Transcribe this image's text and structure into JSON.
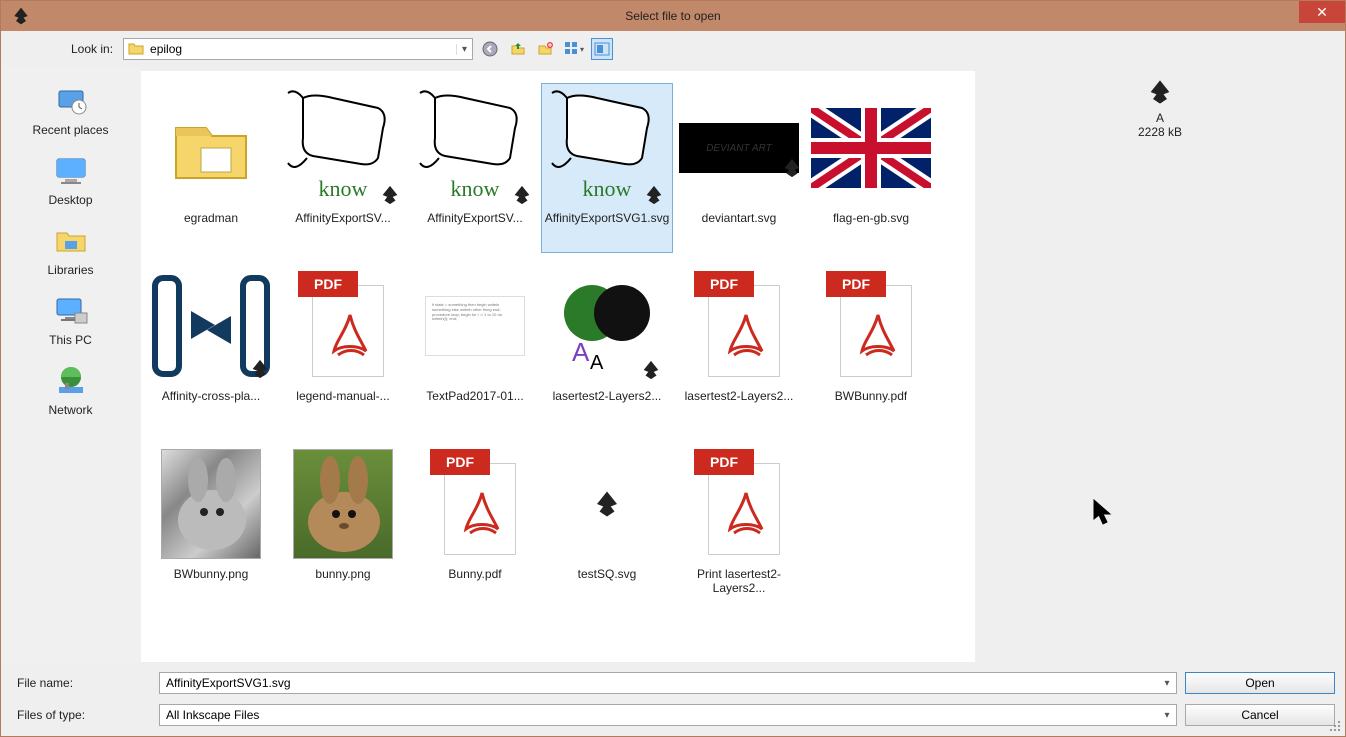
{
  "titlebar": {
    "title": "Select file to open",
    "close": "✕"
  },
  "lookin": {
    "label": "Look in:",
    "value": "epilog"
  },
  "sidebar": {
    "items": [
      {
        "label": "Recent places"
      },
      {
        "label": "Desktop"
      },
      {
        "label": "Libraries"
      },
      {
        "label": "This PC"
      },
      {
        "label": "Network"
      }
    ]
  },
  "files": [
    {
      "name": "egradman",
      "type": "folder"
    },
    {
      "name": "AffinityExportSV...",
      "type": "svg-know"
    },
    {
      "name": "AffinityExportSV...",
      "type": "svg-know"
    },
    {
      "name": "AffinityExportSVG1.svg",
      "type": "svg-know",
      "selected": true
    },
    {
      "name": "deviantart.svg",
      "type": "svg-dark"
    },
    {
      "name": "flag-en-gb.svg",
      "type": "flag"
    },
    {
      "name": "Affinity-cross-pla...",
      "type": "svg-arrows"
    },
    {
      "name": "legend-manual-...",
      "type": "pdf"
    },
    {
      "name": "TextPad2017-01...",
      "type": "text"
    },
    {
      "name": "lasertest2-Layers2...",
      "type": "svg-shapes"
    },
    {
      "name": "lasertest2-Layers2...",
      "type": "pdf"
    },
    {
      "name": "BWBunny.pdf",
      "type": "pdf"
    },
    {
      "name": "BWbunny.png",
      "type": "bw-photo"
    },
    {
      "name": "bunny.png",
      "type": "color-photo"
    },
    {
      "name": "Bunny.pdf",
      "type": "pdf"
    },
    {
      "name": "testSQ.svg",
      "type": "svg-ink"
    },
    {
      "name": "Print lasertest2-Layers2...",
      "type": "pdf"
    }
  ],
  "preview": {
    "name": "A",
    "size": "2228 kB"
  },
  "footer": {
    "filenameLabel": "File name:",
    "filenameValue": "AffinityExportSVG1.svg",
    "filetypeLabel": "Files of type:",
    "filetypeValue": "All Inkscape Files",
    "openLabel": "Open",
    "cancelLabel": "Cancel"
  }
}
